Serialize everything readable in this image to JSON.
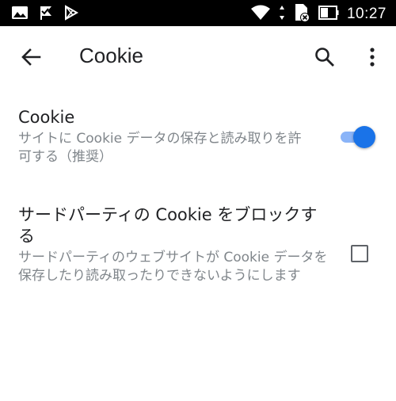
{
  "status_bar": {
    "time": "10:27",
    "icons_left": [
      "image-icon",
      "check-flag-icon",
      "play-store-icon"
    ],
    "icons_right": [
      "wifi-icon",
      "data-arrows-icon",
      "sim-off-icon",
      "battery-icon"
    ]
  },
  "app_bar": {
    "title": "Cookie",
    "back_icon": "arrow-back-icon",
    "search_icon": "search-icon",
    "more_icon": "more-vert-icon"
  },
  "settings": {
    "cookie": {
      "title": "Cookie",
      "summary": "サイトに Cookie データの保存と読み取りを許可する（推奨）",
      "enabled": true
    },
    "third_party": {
      "title": "サードパーティの Cookie をブロックする",
      "summary": "サードパーティのウェブサイトが Cookie データを保存したり読み取ったりできないようにします",
      "checked": false
    }
  },
  "colors": {
    "accent": "#1a73e8",
    "accent_track": "#8ab4f8",
    "text_primary": "#202124",
    "text_secondary": "#80868b",
    "status_bar": "#000000"
  }
}
